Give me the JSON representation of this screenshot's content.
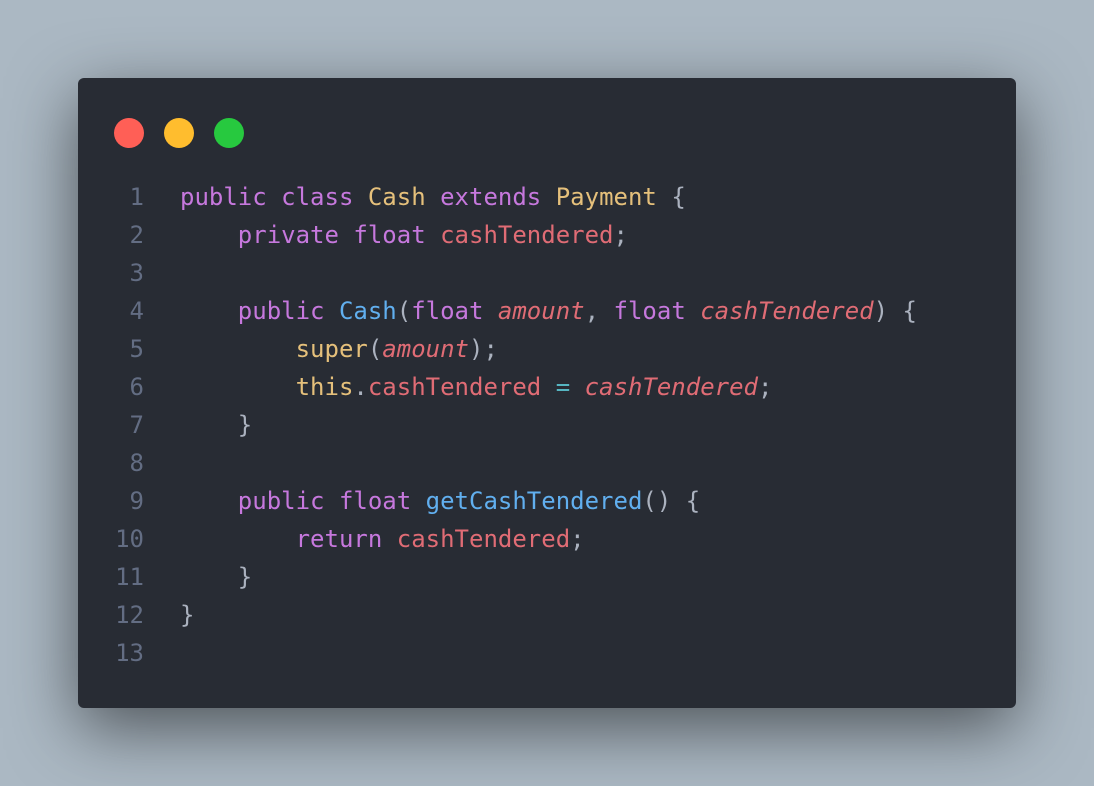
{
  "window": {
    "controls": [
      {
        "name": "close",
        "color": "#ff5f56"
      },
      {
        "name": "minimize",
        "color": "#ffbd2e"
      },
      {
        "name": "maximize",
        "color": "#27c93f"
      }
    ]
  },
  "theme": {
    "background": "#282c34",
    "page_background": "#abb8c3",
    "keyword": "#c678dd",
    "class_name": "#e5c07b",
    "function": "#61afef",
    "variable": "#e06c75",
    "operator": "#56b6c2",
    "punctuation": "#abb2bf",
    "line_number": "#636d83"
  },
  "code": {
    "language": "java",
    "lines": [
      {
        "n": "1",
        "tokens": [
          {
            "t": "public",
            "c": "kw"
          },
          {
            "t": " ",
            "c": "pn"
          },
          {
            "t": "class",
            "c": "kw"
          },
          {
            "t": " ",
            "c": "pn"
          },
          {
            "t": "Cash",
            "c": "cls"
          },
          {
            "t": " ",
            "c": "pn"
          },
          {
            "t": "extends",
            "c": "kw"
          },
          {
            "t": " ",
            "c": "pn"
          },
          {
            "t": "Payment",
            "c": "cls"
          },
          {
            "t": " {",
            "c": "pn"
          }
        ]
      },
      {
        "n": "2",
        "tokens": [
          {
            "t": "    ",
            "c": "pn"
          },
          {
            "t": "private",
            "c": "kw"
          },
          {
            "t": " ",
            "c": "pn"
          },
          {
            "t": "float",
            "c": "kw"
          },
          {
            "t": " ",
            "c": "pn"
          },
          {
            "t": "cashTendered",
            "c": "var"
          },
          {
            "t": ";",
            "c": "pn"
          }
        ]
      },
      {
        "n": "3",
        "tokens": []
      },
      {
        "n": "4",
        "tokens": [
          {
            "t": "    ",
            "c": "pn"
          },
          {
            "t": "public",
            "c": "kw"
          },
          {
            "t": " ",
            "c": "pn"
          },
          {
            "t": "Cash",
            "c": "fn"
          },
          {
            "t": "(",
            "c": "pn"
          },
          {
            "t": "float",
            "c": "kw"
          },
          {
            "t": " ",
            "c": "pn"
          },
          {
            "t": "amount",
            "c": "param"
          },
          {
            "t": ", ",
            "c": "pn"
          },
          {
            "t": "float",
            "c": "kw"
          },
          {
            "t": " ",
            "c": "pn"
          },
          {
            "t": "cashTendered",
            "c": "param"
          },
          {
            "t": ") {",
            "c": "pn"
          }
        ]
      },
      {
        "n": "5",
        "tokens": [
          {
            "t": "        ",
            "c": "pn"
          },
          {
            "t": "super",
            "c": "cls"
          },
          {
            "t": "(",
            "c": "pn"
          },
          {
            "t": "amount",
            "c": "param"
          },
          {
            "t": ");",
            "c": "pn"
          }
        ]
      },
      {
        "n": "6",
        "tokens": [
          {
            "t": "        ",
            "c": "pn"
          },
          {
            "t": "this",
            "c": "cls"
          },
          {
            "t": ".",
            "c": "pn"
          },
          {
            "t": "cashTendered",
            "c": "var"
          },
          {
            "t": " ",
            "c": "pn"
          },
          {
            "t": "=",
            "c": "op"
          },
          {
            "t": " ",
            "c": "pn"
          },
          {
            "t": "cashTendered",
            "c": "param"
          },
          {
            "t": ";",
            "c": "pn"
          }
        ]
      },
      {
        "n": "7",
        "tokens": [
          {
            "t": "    }",
            "c": "pn"
          }
        ]
      },
      {
        "n": "8",
        "tokens": []
      },
      {
        "n": "9",
        "tokens": [
          {
            "t": "    ",
            "c": "pn"
          },
          {
            "t": "public",
            "c": "kw"
          },
          {
            "t": " ",
            "c": "pn"
          },
          {
            "t": "float",
            "c": "kw"
          },
          {
            "t": " ",
            "c": "pn"
          },
          {
            "t": "getCashTendered",
            "c": "fn"
          },
          {
            "t": "() {",
            "c": "pn"
          }
        ]
      },
      {
        "n": "10",
        "tokens": [
          {
            "t": "        ",
            "c": "pn"
          },
          {
            "t": "return",
            "c": "kw"
          },
          {
            "t": " ",
            "c": "pn"
          },
          {
            "t": "cashTendered",
            "c": "var"
          },
          {
            "t": ";",
            "c": "pn"
          }
        ]
      },
      {
        "n": "11",
        "tokens": [
          {
            "t": "    }",
            "c": "pn"
          }
        ]
      },
      {
        "n": "12",
        "tokens": [
          {
            "t": "}",
            "c": "pn"
          }
        ]
      },
      {
        "n": "13",
        "tokens": []
      }
    ]
  }
}
